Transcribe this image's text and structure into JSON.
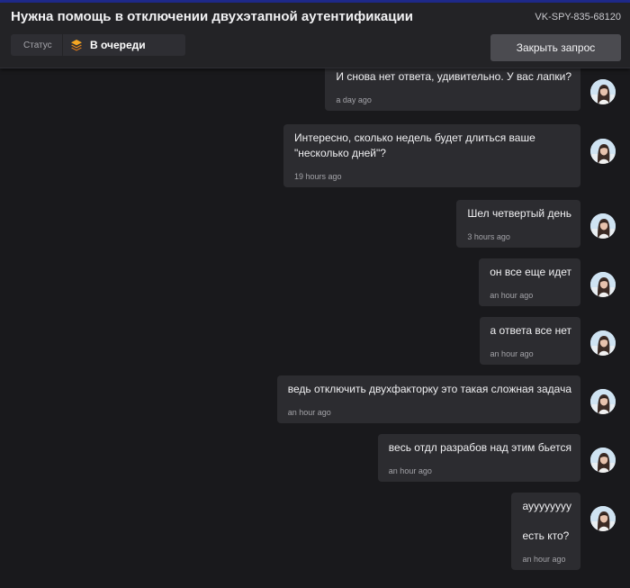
{
  "header": {
    "title": "Нужна помощь в отключении двухэтапной аутентификации",
    "ticket_id": "VK-SPY-835-68120",
    "status_label": "Статус",
    "status_value": "В очереди",
    "close_button": "Закрыть запрос",
    "status_icon": "layers-icon",
    "status_icon_color": "#f5a623",
    "accent_line_color": "#1f2a8c"
  },
  "messages": [
    {
      "lines": [
        "И снова нет ответа, удивительно. У вас лапки?"
      ],
      "time": "a day ago"
    },
    {
      "lines": [
        "Интересно, сколько недель будет длиться ваше \"несколько дней\"?"
      ],
      "time": "19 hours ago"
    },
    {
      "lines": [
        "Шел четвертый день"
      ],
      "time": "3 hours ago"
    },
    {
      "lines": [
        "он все еще идет"
      ],
      "time": "an hour ago"
    },
    {
      "lines": [
        "а ответа все нет"
      ],
      "time": "an hour ago"
    },
    {
      "lines": [
        "ведь отключить двухфакторку это такая сложная задача"
      ],
      "time": "an hour ago"
    },
    {
      "lines": [
        "весь отдл разрабов над этим бьется"
      ],
      "time": "an hour ago"
    },
    {
      "lines": [
        "ауууууууу",
        "есть кто?"
      ],
      "time": "an hour ago"
    }
  ]
}
